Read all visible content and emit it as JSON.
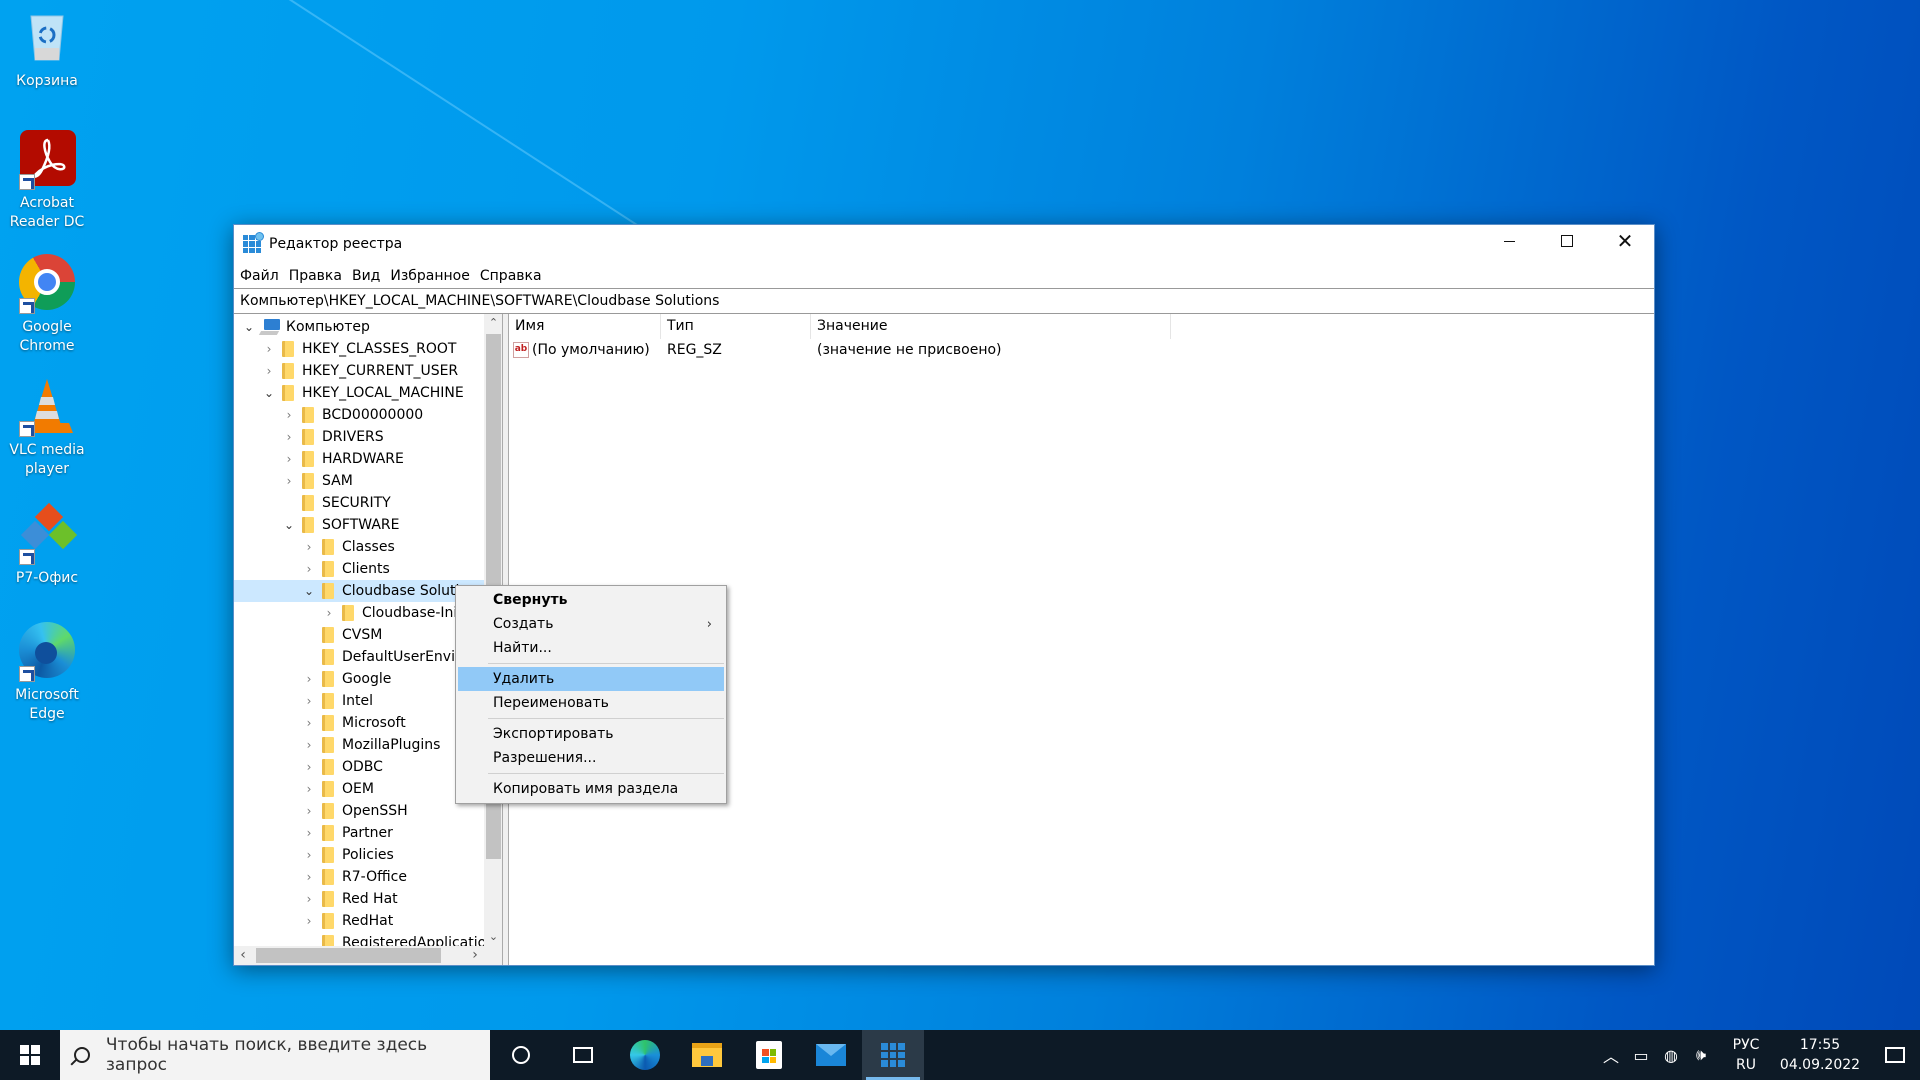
{
  "desktop": {
    "icons": [
      {
        "label": "Корзина",
        "icon": "recycle-bin-icon"
      },
      {
        "label": "Acrobat Reader DC",
        "icon": "acrobat-icon"
      },
      {
        "label": "Google Chrome",
        "icon": "chrome-icon"
      },
      {
        "label": "VLC media player",
        "icon": "vlc-icon"
      },
      {
        "label": "Р7-Офис",
        "icon": "r7-office-icon"
      },
      {
        "label": "Microsoft Edge",
        "icon": "edge-icon"
      }
    ]
  },
  "window": {
    "title": "Редактор реестра",
    "controls": {
      "minimize": "minimize",
      "maximize": "maximize",
      "close": "✕"
    },
    "menu": [
      "Файл",
      "Правка",
      "Вид",
      "Избранное",
      "Справка"
    ],
    "address": "Компьютер\\HKEY_LOCAL_MACHINE\\SOFTWARE\\Cloudbase Solutions"
  },
  "tree": [
    {
      "label": "Компьютер",
      "level": 0,
      "state": "open",
      "kind": "computer"
    },
    {
      "label": "HKEY_CLASSES_ROOT",
      "level": 1,
      "state": "closed"
    },
    {
      "label": "HKEY_CURRENT_USER",
      "level": 1,
      "state": "closed"
    },
    {
      "label": "HKEY_LOCAL_MACHINE",
      "level": 1,
      "state": "open"
    },
    {
      "label": "BCD00000000",
      "level": 2,
      "state": "closed"
    },
    {
      "label": "DRIVERS",
      "level": 2,
      "state": "closed"
    },
    {
      "label": "HARDWARE",
      "level": 2,
      "state": "closed"
    },
    {
      "label": "SAM",
      "level": 2,
      "state": "closed"
    },
    {
      "label": "SECURITY",
      "level": 2,
      "state": "leaf"
    },
    {
      "label": "SOFTWARE",
      "level": 2,
      "state": "open"
    },
    {
      "label": "Classes",
      "level": 3,
      "state": "closed"
    },
    {
      "label": "Clients",
      "level": 3,
      "state": "closed"
    },
    {
      "label": "Cloudbase Solutions",
      "level": 3,
      "state": "open",
      "selected": true
    },
    {
      "label": "Cloudbase-Init",
      "level": 4,
      "state": "closed"
    },
    {
      "label": "CVSM",
      "level": 3,
      "state": "leaf"
    },
    {
      "label": "DefaultUserEnvironment",
      "level": 3,
      "state": "leaf"
    },
    {
      "label": "Google",
      "level": 3,
      "state": "closed"
    },
    {
      "label": "Intel",
      "level": 3,
      "state": "closed"
    },
    {
      "label": "Microsoft",
      "level": 3,
      "state": "closed"
    },
    {
      "label": "MozillaPlugins",
      "level": 3,
      "state": "closed"
    },
    {
      "label": "ODBC",
      "level": 3,
      "state": "closed"
    },
    {
      "label": "OEM",
      "level": 3,
      "state": "closed"
    },
    {
      "label": "OpenSSH",
      "level": 3,
      "state": "closed"
    },
    {
      "label": "Partner",
      "level": 3,
      "state": "closed"
    },
    {
      "label": "Policies",
      "level": 3,
      "state": "closed"
    },
    {
      "label": "R7-Office",
      "level": 3,
      "state": "closed"
    },
    {
      "label": "Red Hat",
      "level": 3,
      "state": "closed"
    },
    {
      "label": "RedHat",
      "level": 3,
      "state": "closed"
    },
    {
      "label": "RegisteredApplications",
      "level": 3,
      "state": "leaf"
    }
  ],
  "list": {
    "columns": [
      "Имя",
      "Тип",
      "Значение"
    ],
    "rows": [
      {
        "name": "(По умолчанию)",
        "type": "REG_SZ",
        "value": "(значение не присвоено)"
      }
    ]
  },
  "context_menu": {
    "items": [
      {
        "label": "Свернуть",
        "bold": true
      },
      {
        "label": "Создать",
        "submenu": true
      },
      {
        "label": "Найти..."
      },
      {
        "sep": true
      },
      {
        "label": "Удалить",
        "highlighted": true
      },
      {
        "label": "Переименовать"
      },
      {
        "sep": true
      },
      {
        "label": "Экспортировать"
      },
      {
        "label": "Разрешения..."
      },
      {
        "sep": true
      },
      {
        "label": "Копировать имя раздела"
      }
    ]
  },
  "taskbar": {
    "search_placeholder": "Чтобы начать поиск, введите здесь запрос",
    "apps": [
      "cortana",
      "task-view",
      "edge",
      "file-explorer",
      "store",
      "mail",
      "regedit"
    ],
    "active_app": "regedit",
    "tray": {
      "lang_top": "РУС",
      "lang_bottom": "RU",
      "time": "17:55",
      "date": "04.09.2022"
    }
  },
  "colors": {
    "selection": "#cce8ff",
    "menu_highlight": "#91c9f7",
    "taskbar": "#0d1a26"
  }
}
